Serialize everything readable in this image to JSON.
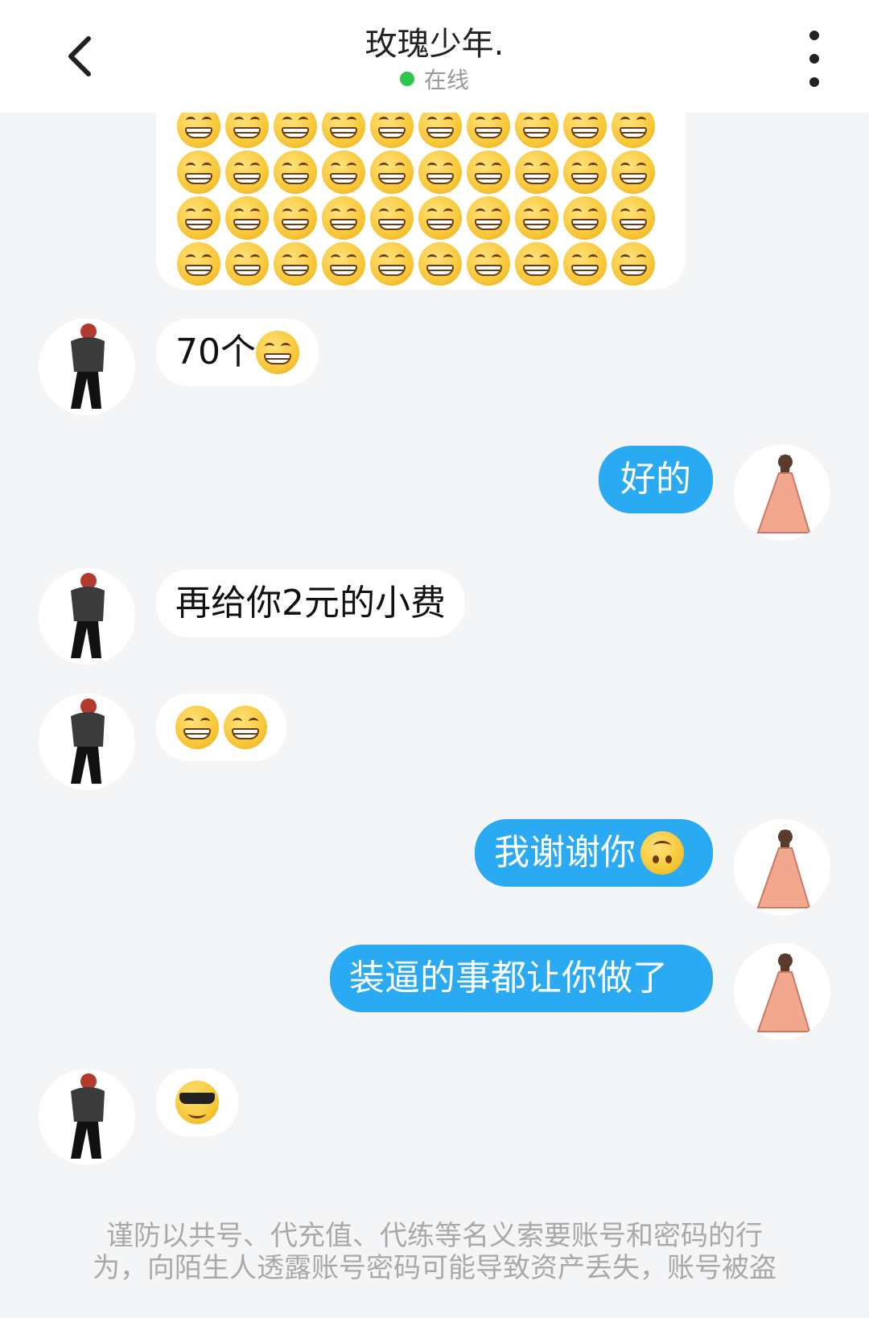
{
  "header": {
    "title": "玫瑰少年.",
    "status": "在线"
  },
  "messages": [
    {
      "side": "in",
      "text": "70个",
      "emoji": "grinning-face"
    },
    {
      "side": "out",
      "text": "好的"
    },
    {
      "side": "in",
      "text": "再给你2元的小费"
    },
    {
      "side": "in",
      "text": "",
      "emoji": "grinning-face x2"
    },
    {
      "side": "out",
      "text": "我谢谢你",
      "emoji": "upside-down-face"
    },
    {
      "side": "out",
      "text": "装逼的事都让你做了"
    },
    {
      "side": "in",
      "text": "",
      "emoji": "smiling-face-with-sunglasses"
    }
  ],
  "disclaimer": {
    "line1": "谨防以共号、代充值、代练等名义索要账号和密码的行",
    "line2": "为，向陌生人透露账号密码可能导致资产丢失，账号被盗"
  },
  "colors": {
    "outgoing_bubble": "#29aaf3",
    "incoming_bubble": "#ffffff",
    "background": "#f4f5f7",
    "online_dot": "#2cc84d"
  }
}
